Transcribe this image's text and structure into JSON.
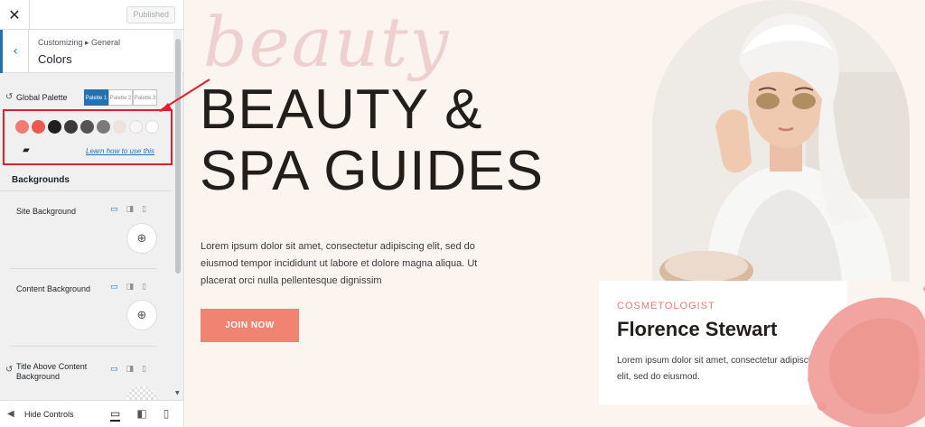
{
  "sidebar": {
    "close_glyph": "✕",
    "published_label": "Published",
    "back_glyph": "‹",
    "breadcrumb": "Customizing ▸ General",
    "section_title": "Colors",
    "reset_glyph": "↺",
    "global_palette_label": "Global Palette",
    "palette_tabs": [
      "Palette 1",
      "Palette 2",
      "Palette 3"
    ],
    "swatch_colors": [
      "#f07b73",
      "#e85a4f",
      "#1f1f1f",
      "#3a3a3a",
      "#545454",
      "#7a7a7a",
      "#ece3dd",
      "#f8f5f2",
      "#ffffff"
    ],
    "folder_glyph": "▰",
    "learn_link": "Learn how to use this",
    "backgrounds_heading": "Backgrounds",
    "options": [
      {
        "label": "Site Background"
      },
      {
        "label": "Content Background"
      },
      {
        "label": "Title Above Content Background"
      }
    ],
    "globe_glyph": "⊕",
    "device_glyphs": [
      "▭",
      "◨",
      "▯"
    ],
    "scroll_down_glyph": "▼",
    "hide_controls_label": "Hide Controls",
    "hide_glyph": "◀",
    "preview_device_glyphs": [
      "▭",
      "◧",
      "▯"
    ]
  },
  "preview": {
    "script_word": "beauty",
    "headline_line1": "BEAUTY &",
    "headline_line2": "SPA GUIDES",
    "lead_text": "Lorem ipsum dolor sit amet, consectetur adipiscing elit, sed do eiusmod tempor incididunt ut labore et dolore magna aliqua. Ut placerat orci nulla pellentesque dignissim",
    "join_button": "JOIN NOW",
    "profile": {
      "role": "COSMETOLOGIST",
      "name": "Florence Stewart",
      "bio": "Lorem ipsum dolor sit amet, consectetur adipiscing elit, sed do eiusmod."
    }
  },
  "colors": {
    "accent": "#2271b1",
    "highlight_border": "#e0202a",
    "button": "#f08372",
    "page_bg": "#fcf4ef"
  }
}
